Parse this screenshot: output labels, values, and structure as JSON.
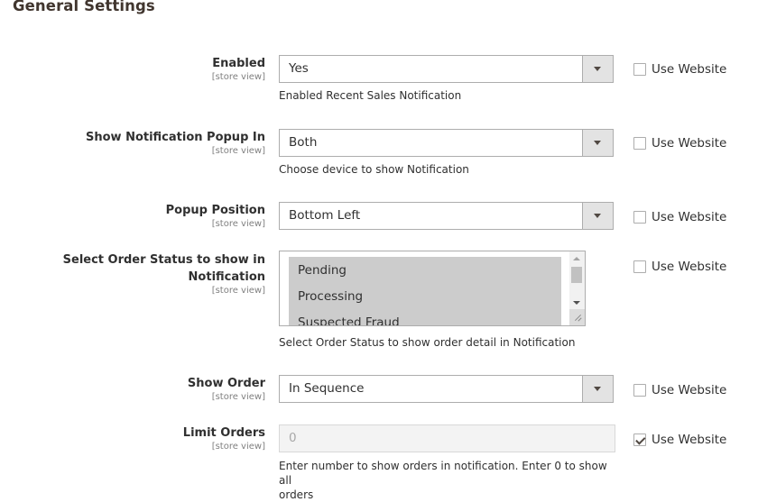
{
  "section": {
    "title": "General Settings"
  },
  "fields": [
    {
      "label": "Enabled",
      "scope": "[store view]",
      "value": "Yes",
      "note": "Enabled Recent Sales Notification",
      "use_website": "Use Website",
      "use_website_checked": false
    },
    {
      "label": "Show Notification Popup In",
      "scope": "[store view]",
      "value": "Both",
      "note": "Choose device to show Notification",
      "use_website": "Use Website",
      "use_website_checked": false
    },
    {
      "label": "Popup Position",
      "scope": "[store view]",
      "value": "Bottom Left",
      "use_website": "Use Website",
      "use_website_checked": false
    },
    {
      "label_line1": "Select Order Status to show in",
      "label_line2": "Notification",
      "scope": "[store view]",
      "options": [
        "Pending",
        "Processing",
        "Suspected Fraud"
      ],
      "note": "Select Order Status to show order detail in Notification",
      "use_website": "Use Website",
      "use_website_checked": false
    },
    {
      "label": "Show Order",
      "scope": "[store view]",
      "value": "In Sequence",
      "use_website": "Use Website",
      "use_website_checked": false
    },
    {
      "label": "Limit Orders",
      "scope": "[store view]",
      "value": "0",
      "note_line1": "Enter number to show orders in notification. Enter 0 to show all",
      "note_line2": "orders",
      "use_website": "Use Website",
      "use_website_checked": true
    }
  ]
}
